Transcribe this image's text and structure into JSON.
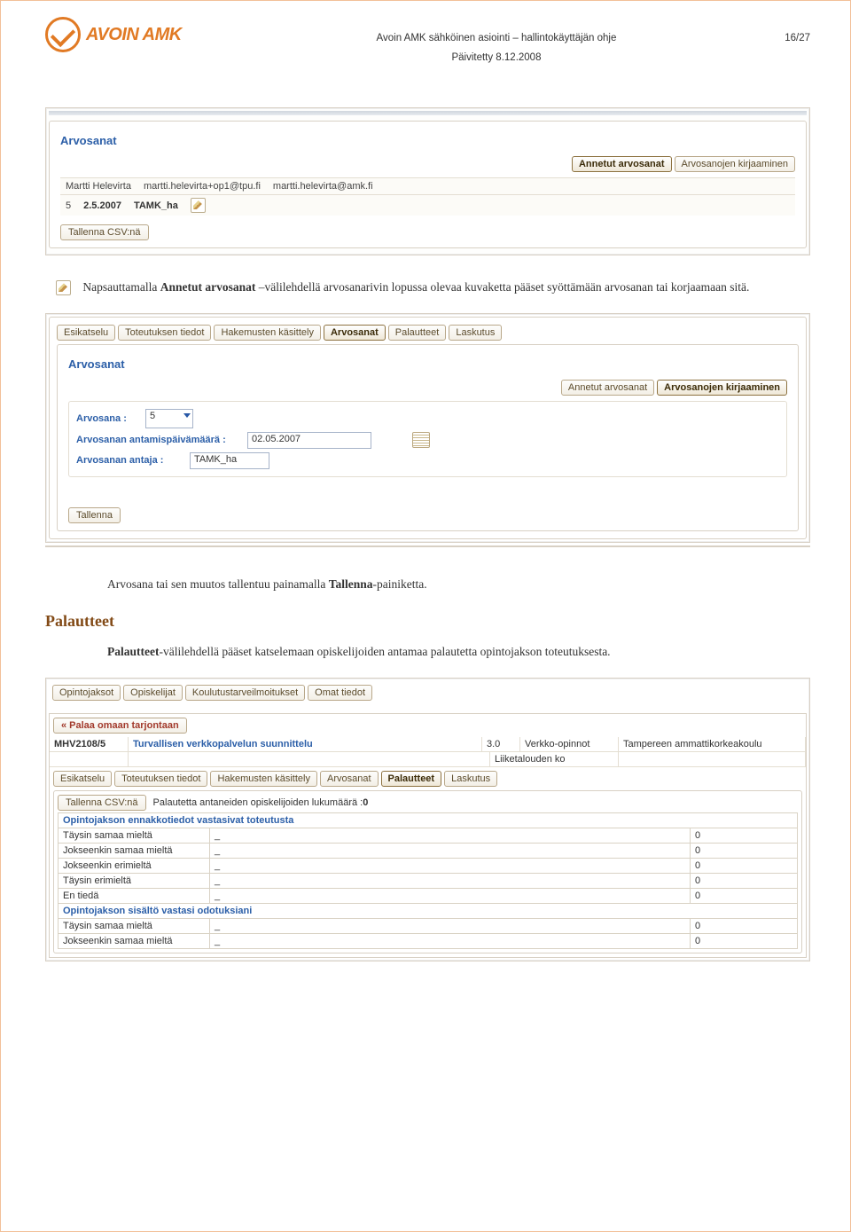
{
  "logo_text": "AVOIN AMK",
  "header": {
    "title": "Avoin AMK sähköinen asiointi – hallintokäyttäjän ohje",
    "updated": "Päivitetty 8.12.2008",
    "page": "16/27"
  },
  "panel1": {
    "title": "Arvosanat",
    "tabs": [
      "Annetut arvosanat",
      "Arvosanojen kirjaaminen"
    ],
    "row1": {
      "name": "Martti Helevirta",
      "email1": "martti.helevirta+op1@tpu.fi",
      "email2": "martti.helevirta@amk.fi"
    },
    "row2": {
      "num": "5",
      "date": "2.5.2007",
      "user": "TAMK_ha"
    },
    "csv": "Tallenna CSV:nä"
  },
  "body1_prefix": "Napsauttamalla ",
  "body1_bold": "Annetut arvosanat",
  "body1_suffix": " –välilehdellä arvosanarivin lopussa olevaa kuvaketta pääset syöttämään arvosanan tai korjaamaan sitä.",
  "panel2": {
    "tabs": [
      "Esikatselu",
      "Toteutuksen tiedot",
      "Hakemusten käsittely",
      "Arvosanat",
      "Palautteet",
      "Laskutus"
    ],
    "title": "Arvosanat",
    "subtabs": [
      "Annetut arvosanat",
      "Arvosanojen kirjaaminen"
    ],
    "grade_label": "Arvosana :",
    "grade_value": "5",
    "date_label": "Arvosanan antamispäivämäärä :",
    "date_value": "02.05.2007",
    "giver_label": "Arvosanan antaja :",
    "giver_value": "TAMK_ha",
    "save": "Tallenna"
  },
  "body2": "Arvosana tai sen muutos tallentuu painamalla ",
  "body2_bold": "Tallenna",
  "body2_suffix": "-painiketta.",
  "heading": "Palautteet",
  "body3_bold": "Palautteet",
  "body3_suffix": "-välilehdellä pääset katselemaan opiskelijoiden antamaa palautetta opintojakson toteutuksesta.",
  "panel3": {
    "toptabs": [
      "Opintojaksot",
      "Opiskelijat",
      "Koulutustarveilmoitukset",
      "Omat tiedot"
    ],
    "back": "« Palaa omaan tarjontaan",
    "course": {
      "code": "MHV2108/5",
      "name": "Turvallisen verkkopalvelun suunnittelu",
      "credits": "3.0",
      "type": "Verkko-opinnot",
      "org": "Tampereen ammattikorkeakoulu",
      "dept": "Liiketalouden ko"
    },
    "subtabs": [
      "Esikatselu",
      "Toteutuksen tiedot",
      "Hakemusten käsittely",
      "Arvosanat",
      "Palautteet",
      "Laskutus"
    ],
    "csv": "Tallenna CSV:nä",
    "count_label": "Palautetta antaneiden opiskelijoiden lukumäärä :",
    "count_value": "0",
    "q1": "Opintojakson ennakkotiedot vastasivat toteutusta",
    "q2": "Opintojakson sisältö vastasi odotuksiani",
    "rows1": [
      {
        "label": "Täysin samaa mieltä",
        "bar": "_",
        "n": "0"
      },
      {
        "label": "Jokseenkin samaa mieltä",
        "bar": "_",
        "n": "0"
      },
      {
        "label": "Jokseenkin erimieltä",
        "bar": "_",
        "n": "0"
      },
      {
        "label": "Täysin erimieltä",
        "bar": "_",
        "n": "0"
      },
      {
        "label": "En tiedä",
        "bar": "_",
        "n": "0"
      }
    ],
    "rows2": [
      {
        "label": "Täysin samaa mieltä",
        "bar": "_",
        "n": "0"
      },
      {
        "label": "Jokseenkin samaa mieltä",
        "bar": "_",
        "n": "0"
      }
    ]
  }
}
